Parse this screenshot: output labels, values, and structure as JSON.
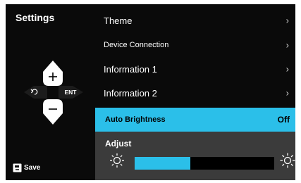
{
  "title": "Settings",
  "menu": {
    "items": [
      {
        "label": "Theme"
      },
      {
        "label": "Device Connection"
      },
      {
        "label": "Information 1"
      },
      {
        "label": "Information 2"
      }
    ],
    "selected": {
      "label": "Auto Brightness",
      "value": "Off"
    },
    "adjust": {
      "label": "Adjust",
      "level_percent": 40
    }
  },
  "controls": {
    "enter_label": "ENT",
    "back_icon": "back-arrow-icon",
    "up_icon": "plus-icon",
    "down_icon": "minus-icon"
  },
  "footer": {
    "save_label": "Save",
    "save_icon": "save-icon"
  },
  "colors": {
    "accent": "#2bbfe9",
    "background": "#0a0a0a",
    "panel": "#3b3b3b"
  }
}
